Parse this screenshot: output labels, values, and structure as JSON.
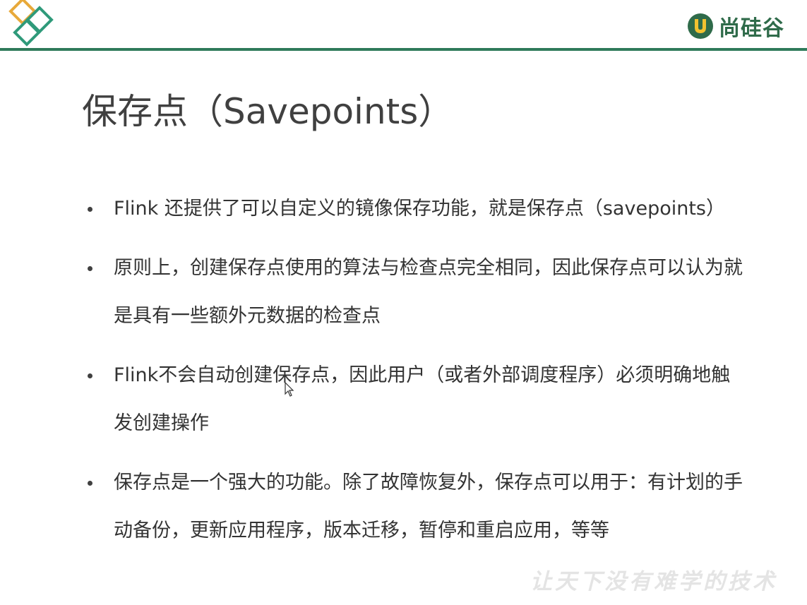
{
  "header": {
    "brand_text": "尚硅谷",
    "brand_icon": "u-shield-icon",
    "accent_color": "#2f7a5a",
    "diamond_colors": [
      "#e8a93a",
      "#2f9a7a"
    ]
  },
  "slide": {
    "title": "保存点（Savepoints）",
    "bullets": [
      "Flink 还提供了可以自定义的镜像保存功能，就是保存点（savepoints）",
      "原则上，创建保存点使用的算法与检查点完全相同，因此保存点可以认为就是具有一些额外元数据的检查点",
      "Flink不会自动创建保存点，因此用户（或者外部调度程序）必须明确地触发创建操作",
      "保存点是一个强大的功能。除了故障恢复外，保存点可以用于：有计划的手动备份，更新应用程序，版本迁移，暂停和重启应用，等等"
    ]
  },
  "watermark": "让天下没有难学的技术"
}
